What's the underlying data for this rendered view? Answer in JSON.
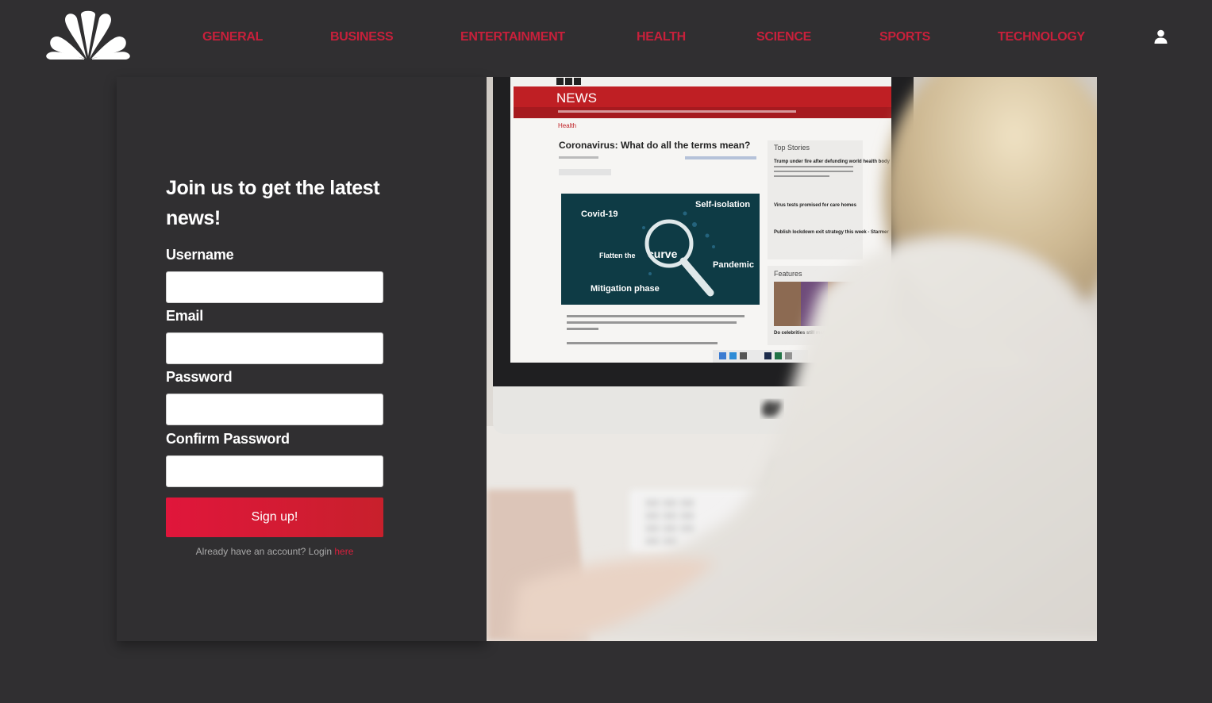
{
  "nav": {
    "logo": "peacock-logo",
    "links": [
      "GENERAL",
      "BUSINESS",
      "ENTERTAINMENT",
      "HEALTH",
      "SCIENCE",
      "SPORTS",
      "TECHNOLOGY"
    ],
    "user_icon": "user-icon",
    "link_color": "#c8203b"
  },
  "form": {
    "heading": "Join us to get the latest news!",
    "fields": [
      {
        "label": "Username",
        "value": "",
        "type": "text"
      },
      {
        "label": "Email",
        "value": "",
        "type": "email"
      },
      {
        "label": "Password",
        "value": "",
        "type": "password"
      },
      {
        "label": "Confirm Password",
        "value": "",
        "type": "password"
      }
    ],
    "submit_label": "Sign up!",
    "login_prompt": "Already have an account? Login ",
    "login_link": "here",
    "accent_color": "#e0163b"
  },
  "photo": {
    "site_name": "NEWS",
    "section": "Health",
    "headline": "Coronavirus: What do all the terms mean?",
    "graphic_terms": [
      "Covid-19",
      "Self-isolation",
      "Flatten the",
      "curve",
      "Pandemic",
      "Mitigation phase"
    ],
    "sidebar_title": "Top Stories",
    "sidebar_stories": [
      "Trump under fire after defunding world health body",
      "Virus tests promised for care homes",
      "Publish lockdown exit strategy this week - Starmer"
    ],
    "features_title": "Features",
    "features_caption": "Do celebrities still matter in a crisis?"
  }
}
